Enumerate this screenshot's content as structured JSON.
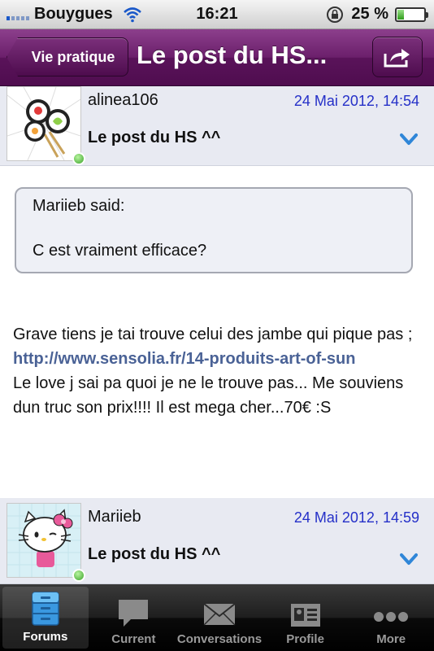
{
  "status_bar": {
    "carrier": "Bouygues",
    "time": "16:21",
    "battery": "25 %",
    "battery_level": 0.25
  },
  "nav": {
    "back_label": "Vie pratique",
    "title": "Le post du HS...",
    "share_icon": "share-icon"
  },
  "posts": [
    {
      "username": "alinea106",
      "date": "24 Mai 2012, 14:54",
      "title": "Le post du HS ^^",
      "avatar_icon": "sushi-avatar"
    },
    {
      "username": "Mariieb",
      "date": "24 Mai 2012, 14:59",
      "title": "Le post du HS ^^",
      "avatar_icon": "hello-kitty-avatar"
    }
  ],
  "quote": {
    "author": "Mariieb said:",
    "text": "C est vraiment efficace?"
  },
  "body": {
    "text_before_link": "Grave tiens je tai trouve celui des jambe qui pique pas ; ",
    "link": "http://www.sensolia.fr/14-produits-art-of-sun",
    "text_after_link": "Le love j sai pa quoi je ne le trouve pas... Me souviens dun truc son prix!!!! Il est mega cher...70€ :S"
  },
  "tabs": [
    {
      "label": "Forums",
      "icon": "forums-icon",
      "active": true
    },
    {
      "label": "Current",
      "icon": "speech-bubble-icon",
      "active": false
    },
    {
      "label": "Conversations",
      "icon": "envelope-icon",
      "active": false
    },
    {
      "label": "Profile",
      "icon": "profile-card-icon",
      "active": false
    },
    {
      "label": "More",
      "icon": "more-dots-icon",
      "active": false
    }
  ],
  "colors": {
    "nav_purple": "#6b1f6b",
    "date_blue": "#2530c8",
    "link_blue": "#4a6296",
    "header_bg": "#e8eaf2"
  }
}
